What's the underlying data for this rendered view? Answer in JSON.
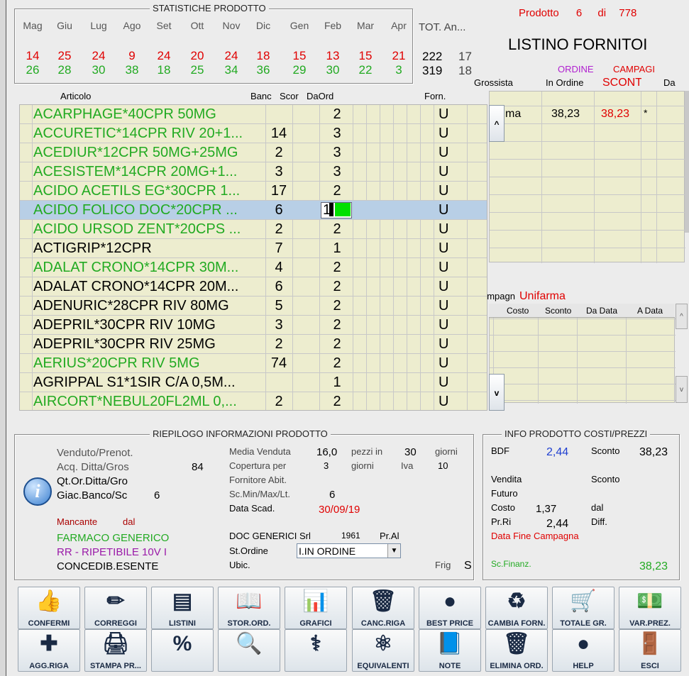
{
  "stats": {
    "title": "STATISTICHE PRODOTTO",
    "months": [
      "Mag",
      "Giu",
      "Lug",
      "Ago",
      "Set",
      "Ott",
      "Nov",
      "Dic",
      "Gen",
      "Feb",
      "Mar",
      "Apr"
    ],
    "row1": [
      "14",
      "25",
      "24",
      "9",
      "24",
      "20",
      "24",
      "18",
      "15",
      "13",
      "15",
      "21"
    ],
    "row2": [
      "26",
      "28",
      "30",
      "38",
      "18",
      "25",
      "34",
      "36",
      "29",
      "30",
      "22",
      "3"
    ],
    "tot_label": "TOT. An...",
    "tot1": "222",
    "tot1b": "17",
    "tot2": "319",
    "tot2b": "18"
  },
  "product_counter": {
    "label": "Prodotto",
    "current": "6",
    "of": "di",
    "total": "778"
  },
  "listino_title": "LISTINO FORNITOI",
  "supplier_table": {
    "h_ordine": "ORDINE",
    "h_campagna": "CAMPAGI",
    "col_grossista": "Grossista",
    "col_in_ordine": "In Ordine",
    "col_sconto": "SCONT",
    "col_da": "Da",
    "row": {
      "name": "ma",
      "val1": "38,23",
      "val2": "38,23",
      "flag": "*"
    }
  },
  "campaign": {
    "prefix": "ampagn",
    "name": "Unifarma",
    "cols": [
      "Costo",
      "Sconto",
      "Da Data",
      "A Data"
    ]
  },
  "articles_header": {
    "articolo": "Articolo",
    "banc": "Banc",
    "scor": "Scor",
    "daord": "DaOrd",
    "forn": "Forn."
  },
  "articles": [
    {
      "name": "ACARPHAGE*40CPR 50MG",
      "banc": "",
      "daord": "2",
      "forn": "U",
      "green": true
    },
    {
      "name": "ACCURETIC*14CPR RIV 20+1...",
      "banc": "14",
      "daord": "3",
      "forn": "U",
      "green": true
    },
    {
      "name": "ACEDIUR*12CPR 50MG+25MG",
      "banc": "2",
      "daord": "3",
      "forn": "U",
      "green": true
    },
    {
      "name": "ACESISTEM*14CPR 20MG+1...",
      "banc": "3",
      "daord": "3",
      "forn": "U",
      "green": true
    },
    {
      "name": "ACIDO ACETILS EG*30CPR 1...",
      "banc": "17",
      "daord": "2",
      "forn": "U",
      "green": true
    },
    {
      "name": "ACIDO FOLICO DOC*20CPR ...",
      "banc": "6",
      "daord": "1",
      "forn": "U",
      "green": true,
      "selected": true
    },
    {
      "name": "ACIDO URSOD ZENT*20CPS ...",
      "banc": "2",
      "daord": "2",
      "forn": "U",
      "green": true
    },
    {
      "name": "ACTIGRIP*12CPR",
      "banc": "7",
      "daord": "1",
      "forn": "U",
      "green": false
    },
    {
      "name": "ADALAT CRONO*14CPR 30M...",
      "banc": "4",
      "daord": "2",
      "forn": "U",
      "green": true
    },
    {
      "name": "ADALAT CRONO*14CPR 20M...",
      "banc": "6",
      "daord": "2",
      "forn": "U",
      "green": false
    },
    {
      "name": "ADENURIC*28CPR RIV 80MG",
      "banc": "5",
      "daord": "2",
      "forn": "U",
      "green": false
    },
    {
      "name": "ADEPRIL*30CPR RIV 10MG",
      "banc": "3",
      "daord": "2",
      "forn": "U",
      "green": false
    },
    {
      "name": "ADEPRIL*30CPR RIV 25MG",
      "banc": "2",
      "daord": "2",
      "forn": "U",
      "green": false
    },
    {
      "name": "AERIUS*20CPR RIV 5MG",
      "banc": "74",
      "daord": "2",
      "forn": "U",
      "green": true
    },
    {
      "name": "AGRIPPAL S1*1SIR C/A 0,5M...",
      "banc": "",
      "daord": "1",
      "forn": "U",
      "green": false
    },
    {
      "name": "AIRCORT*NEBUL20FL2ML 0,...",
      "banc": "2",
      "daord": "2",
      "forn": "U",
      "green": true
    }
  ],
  "riepilogo": {
    "title": "RIEPILOGO INFORMAZIONI PRODOTTO",
    "venduto": "Venduto/Prenot.",
    "acq": "Acq. Ditta/Gros",
    "acq_val": "84",
    "qtor": "Qt.Or.Ditta/Gro",
    "giac": "Giac.Banco/Sc",
    "giac_val": "6",
    "mancante": "Mancante",
    "dal": "dal",
    "generico": "FARMACO GENERICO",
    "rr": "RR - RIPETIBILE 10V I",
    "concedib": "CONCEDIB.ESENTE",
    "media": "Media Venduta",
    "media_val": "16,0",
    "pezzi": "pezzi in",
    "pezzi_val": "30",
    "giorni": "giorni",
    "copertura": "Copertura per",
    "cop_val": "3",
    "giorni2": "giorni",
    "iva": "Iva",
    "iva_val": "10",
    "fornitore": "Fornitore Abit.",
    "scmin": "Sc.Min/Max/Lt.",
    "scmin_val": "6",
    "scad": "Data Scad.",
    "scad_val": "30/09/19",
    "ditta": "DOC GENERICI Srl",
    "ditta_code": "1961",
    "pral": "Pr.Al",
    "stordine": "St.Ordine",
    "stordine_val": "I.IN ORDINE",
    "ubic": "Ubic.",
    "frig": "Frig",
    "frig_val": "S"
  },
  "costi": {
    "title": "INFO PRODOTTO COSTI/PREZZI",
    "bdf": "BDF",
    "bdf_val": "2,44",
    "sconto": "Sconto",
    "sconto_val": "38,23",
    "vendita": "Vendita",
    "sconto2": "Sconto",
    "futuro": "Futuro",
    "costo": "Costo",
    "costo_val": "1,37",
    "dal": "dal",
    "prri": "Pr.Ri",
    "prri_val": "2,44",
    "diff": "Diff.",
    "fine": "Data Fine Campagna",
    "scfin": "Sc.Finanz.",
    "scfin_val": "38,23"
  },
  "buttons_row1": [
    {
      "label": "CONFERMI",
      "icon": "thumbs-up-icon",
      "glyph": "👍"
    },
    {
      "label": "CORREGGI",
      "icon": "pencil-icon",
      "glyph": "✏"
    },
    {
      "label": "LISTINI",
      "icon": "list-window-icon",
      "glyph": "▤"
    },
    {
      "label": "STOR.ORD.",
      "icon": "book-icon",
      "glyph": "📖"
    },
    {
      "label": "GRAFICI",
      "icon": "chart-icon",
      "glyph": "📊"
    },
    {
      "label": "CANC.RIGA",
      "icon": "trash-icon",
      "glyph": "🗑"
    },
    {
      "label": "BEST PRICE",
      "icon": "best-price-badge-icon",
      "glyph": "●"
    },
    {
      "label": "CAMBIA FORN.",
      "icon": "recycle-icon",
      "glyph": "♻"
    },
    {
      "label": "TOTALE GR.",
      "icon": "cart-icon",
      "glyph": "🛒"
    },
    {
      "label": "VAR.PREZ.",
      "icon": "money-icon",
      "glyph": "💵"
    }
  ],
  "buttons_row2": [
    {
      "label": "AGG.RIGA",
      "icon": "plus-icon",
      "glyph": "✚"
    },
    {
      "label": "STAMPA PR...",
      "icon": "printer-icon",
      "glyph": "🖨"
    },
    {
      "label": "",
      "icon": "percent-icon",
      "glyph": "%"
    },
    {
      "label": "",
      "icon": "magnifier-icon",
      "glyph": "🔍"
    },
    {
      "label": "",
      "icon": "caduceus-icon",
      "glyph": "⚕"
    },
    {
      "label": "EQUIVALENTI",
      "icon": "molecule-icon",
      "glyph": "⚛"
    },
    {
      "label": "NOTE",
      "icon": "note-icon",
      "glyph": "📘"
    },
    {
      "label": "ELIMINA ORD.",
      "icon": "bin-icon",
      "glyph": "🗑"
    },
    {
      "label": "HELP",
      "icon": "help-button-icon",
      "glyph": "●"
    },
    {
      "label": "ESCI",
      "icon": "exit-door-icon",
      "glyph": "🚪"
    }
  ]
}
